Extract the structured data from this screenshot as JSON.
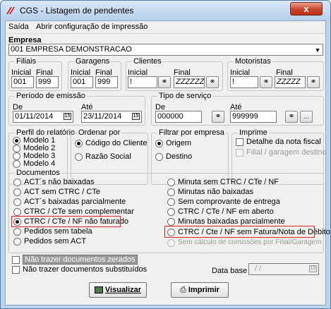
{
  "window": {
    "title": "CGS - Listagem de pendentes",
    "close_glyph": "x"
  },
  "menu": {
    "saida": "Saída",
    "config": "Abrir configuração de impressão"
  },
  "empresa": {
    "label": "Empresa",
    "value": "001 EMPRESA DEMONSTRACAO"
  },
  "filiais": {
    "label": "Filiais",
    "inicial_label": "Inicial",
    "final_label": "Final",
    "inicial": "001",
    "final": "999"
  },
  "garagens": {
    "label": "Garagens",
    "inicial_label": "Inicial",
    "final_label": "Final",
    "inicial": "001",
    "final": "999"
  },
  "clientes": {
    "label": "Clientes",
    "inicial_label": "Inicial",
    "final_label": "Final",
    "inicial": "!",
    "final": "ZZZZZZ"
  },
  "motoristas": {
    "label": "Motoristas",
    "inicial_label": "Inicial",
    "final_label": "Final",
    "inicial": "!",
    "final": "ZZZZZ"
  },
  "periodo": {
    "label": "Período de emissão",
    "de_label": "De",
    "ate_label": "Até",
    "de": "01/11/2014",
    "ate": "23/11/2014"
  },
  "tipo_servico": {
    "label": "Tipo de serviço",
    "de_label": "De",
    "ate_label": "Até",
    "de": "000000",
    "ate": "999999",
    "more": "..."
  },
  "perfil": {
    "label": "Perfil do relatório",
    "options": [
      "Modelo 1",
      "Modelo 2",
      "Modelo 3",
      "Modelo 4"
    ]
  },
  "ordenar": {
    "label": "Ordenar por",
    "options": [
      "Código do Cliente",
      "Razão Social"
    ]
  },
  "filtrar": {
    "label": "Filtrar por empresa",
    "options": [
      "Origem",
      "Destino"
    ]
  },
  "imprime": {
    "label": "Imprime",
    "options": [
      "Detalhe da nota fiscal",
      "Filial / garagem destino"
    ]
  },
  "documentos": {
    "label": "Documentos",
    "left": [
      "ACT´s não baixadas",
      "ACT sem CTRC / CTe",
      "ACT´s baixadas parcialmente",
      "CTRC / CTe sem complementar",
      "CTRC / CTe / NF não faturado",
      "Pedidos sem tabela",
      "Pedidos sem ACT"
    ],
    "right": [
      "Minuta sem CTRC / CTe / NF",
      "Minutas não baixadas",
      "Sem comprovante de entrega",
      "CTRC / CTe / NF em aberto",
      "Minutas baixadas parcialmente",
      "CTRC / Cte / NF sem Fatura/Nota de Débito",
      "Sem cálculo de comissões por Filial/Garagem"
    ]
  },
  "checks": {
    "zerados": "Não trazer documentos zerados",
    "substituidos": "Não trazer documentos substituídos"
  },
  "data_base": {
    "label": "Data base",
    "value": "/ /"
  },
  "buttons": {
    "visualizar": "Visualizar",
    "imprimir": "Imprimir"
  },
  "colors": {
    "titlebar": "#b7cfec",
    "close": "#c8422b",
    "highlight": "#e02020"
  }
}
